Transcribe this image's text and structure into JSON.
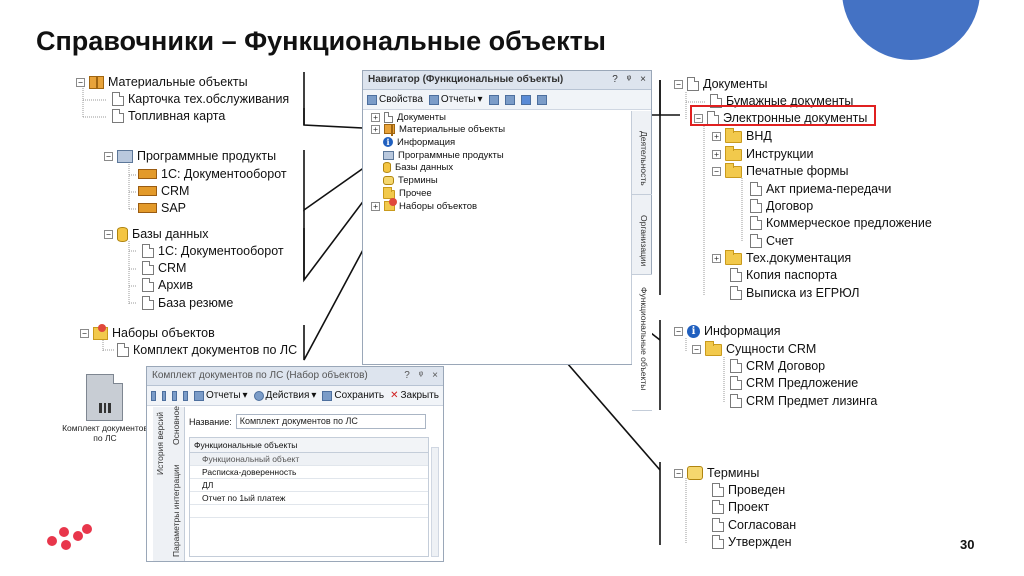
{
  "slide": {
    "title": "Справочники – Функциональные объекты",
    "page_number": "30"
  },
  "left_tree": {
    "material": "Материальные объекты",
    "card": "Карточка тех.обслуживания",
    "fuel": "Топливная карта",
    "software": "Программные продукты",
    "sw_1c": "1С: Документооборот",
    "sw_crm": "CRM",
    "sw_sap": "SAP",
    "databases": "Базы данных",
    "db_1c": "1С: Документооборот",
    "db_crm": "CRM",
    "db_archive": "Архив",
    "db_resume": "База резюме",
    "sets": "Наборы объектов",
    "set_docs": "Комплект документов по ЛС"
  },
  "navigator": {
    "title": "Навигатор (Функциональные объекты)",
    "ctrl_help": "?",
    "ctrl_pin": "ᵠ",
    "ctrl_close": "×",
    "tb_props": "Свойства",
    "tb_reports": "Отчеты",
    "tree": {
      "docs": "Документы",
      "material": "Материальные объекты",
      "info": "Информация",
      "software": "Программные продукты",
      "databases": "Базы данных",
      "terms": "Термины",
      "other": "Прочее",
      "sets": "Наборы объектов"
    },
    "side_tabs": {
      "activity": "Деятельность",
      "orgs": "Организации",
      "func": "Функциональные объекты"
    }
  },
  "document_window": {
    "title": "Комплект документов по ЛС (Набор объектов)",
    "tb_reports": "Отчеты",
    "tb_actions": "Действия",
    "tb_save": "Сохранить",
    "tb_close": "Закрыть",
    "vtab_history": "История версий",
    "vtab_main": "Основное",
    "vtab_params": "Параметры интеграции",
    "name_label": "Название:",
    "name_value": "Комплект документов по ЛС",
    "grid_caption": "Функциональные объекты",
    "grid_header": "Функциональный объект",
    "rows": [
      "Расписка-доверенность",
      "ДЛ",
      "Отчет по 1ый платеж"
    ]
  },
  "doc_icon_caption": "Комплект документов по ЛС",
  "right_tree": {
    "docs": "Документы",
    "paper": "Бумажные документы",
    "electronic": "Электронные документы",
    "vnd": "ВНД",
    "instructions": "Инструкции",
    "print_forms": "Печатные формы",
    "act": "Акт приема-передачи",
    "contract": "Договор",
    "offer": "Коммерческое предложение",
    "invoice": "Счет",
    "tech_docs": "Тех.документация",
    "passport": "Копия паспорта",
    "egrul": "Выписка из ЕГРЮЛ",
    "info": "Информация",
    "crm_entities": "Сущности CRM",
    "crm_contract": "CRM Договор",
    "crm_offer": "CRM Предложение",
    "crm_leasing": "CRM Предмет лизинга",
    "terms": "Термины",
    "held": "Проведен",
    "draft": "Проект",
    "agreed": "Согласован",
    "approved": "Утвержден"
  },
  "colors": {
    "accent_circle": "#4472c4",
    "highlight": "#e02020",
    "logo": "#e8364b"
  }
}
